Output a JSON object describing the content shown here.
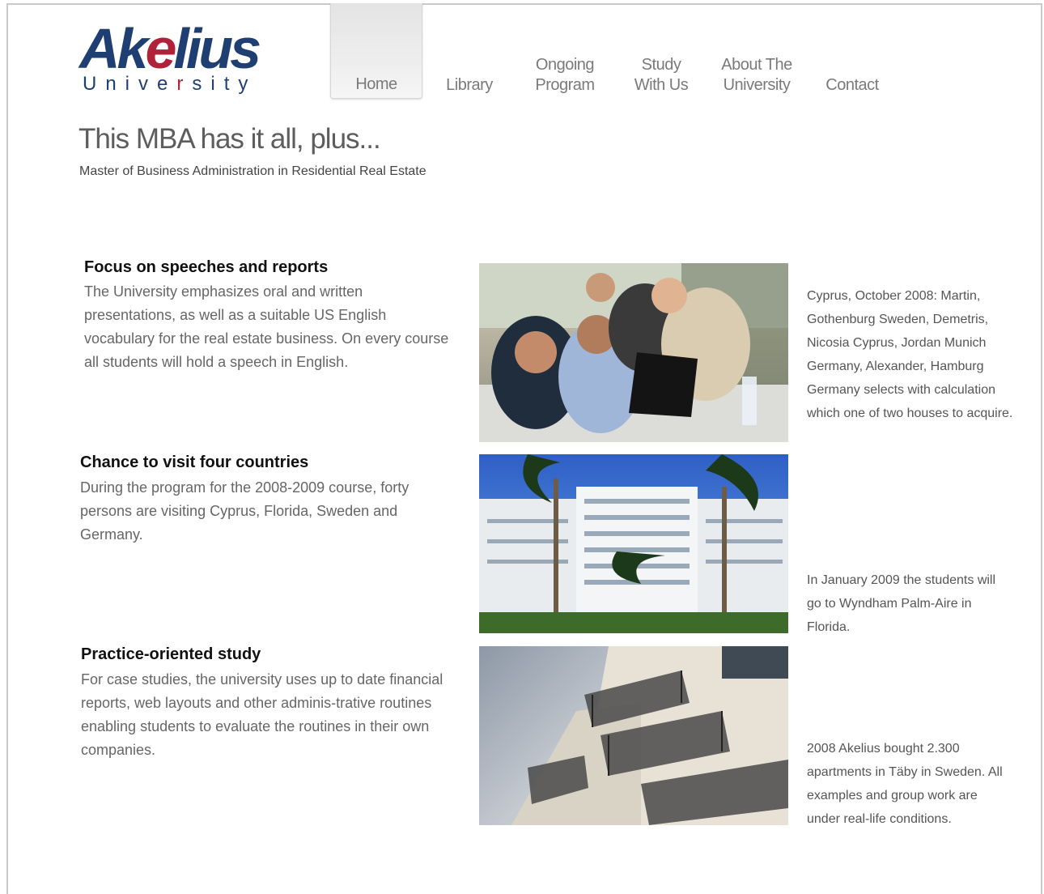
{
  "logo": {
    "word_a": "Ak",
    "word_accent": "e",
    "word_b": "lius",
    "sub_a": "Unive",
    "sub_accent": "r",
    "sub_b": "sity"
  },
  "nav": {
    "items": [
      {
        "lines": [
          "Home"
        ]
      },
      {
        "lines": [
          "Library"
        ]
      },
      {
        "lines": [
          "Ongoing",
          "Program"
        ]
      },
      {
        "lines": [
          "Study",
          "With Us"
        ]
      },
      {
        "lines": [
          "About The",
          "University"
        ]
      },
      {
        "lines": [
          "Contact"
        ]
      }
    ]
  },
  "header": {
    "headline": "This MBA has it all, plus...",
    "subhead": "Master of Business Administration in Residential Real Estate"
  },
  "sections": [
    {
      "title": "Focus on speeches and reports",
      "body": "The University emphasizes oral and written presentations, as well as a suitable US English vocabulary for the real estate business. On every course all students will hold a speech in English.",
      "caption": "Cyprus, October 2008: Martin, Gothenburg Sweden, Demetris, Nicosia Cyprus, Jordan Munich Germany, Alexander, Hamburg Germany selects with calculation which one of two houses to acquire."
    },
    {
      "title": "Chance to visit four countries",
      "body": "During the program for the 2008-2009 course, forty persons are visiting Cyprus, Florida, Sweden and Germany.",
      "caption": "In January 2009 the students will go to Wyndham Palm-Aire in Florida."
    },
    {
      "title": "Practice-oriented study",
      "body": "For case studies, the university uses up to date financial reports, web layouts and other adminis-trative routines enabling students to evaluate the routines in their own companies.",
      "caption": "2008 Akelius bought 2.300 apartments in Täby in Sweden. All examples and group work are under real-life conditions."
    }
  ]
}
